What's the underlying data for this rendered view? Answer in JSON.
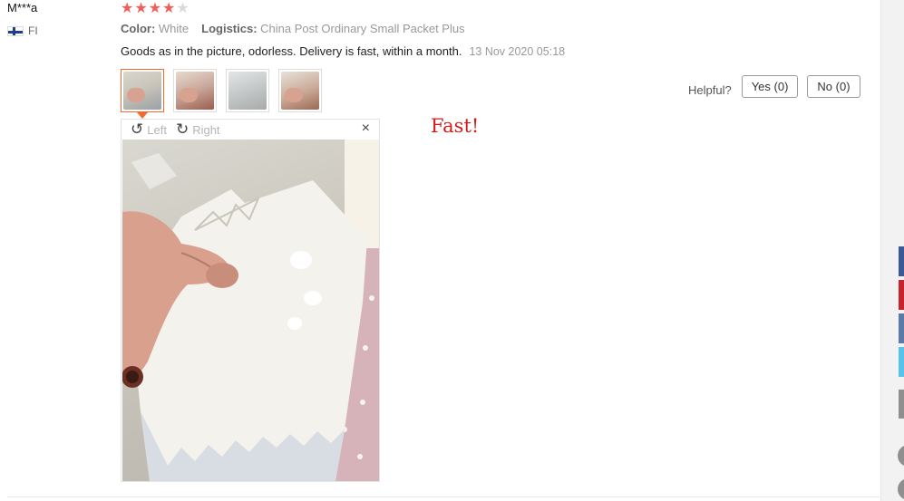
{
  "reviewer": {
    "name": "M***a",
    "country_code": "FI"
  },
  "rating": {
    "stars_filled": 4,
    "stars_total": 5
  },
  "attributes": [
    {
      "label": "Color:",
      "value": "White"
    },
    {
      "label": "Logistics:",
      "value": "China Post Ordinary Small Packet Plus"
    }
  ],
  "review": {
    "text": "Goods as in the picture, odorless. Delivery is fast, within a month.",
    "date": "13 Nov 2020 05:18"
  },
  "helpful": {
    "label": "Helpful?",
    "yes": "Yes (0)",
    "no": "No (0)"
  },
  "viewer": {
    "rotate_left": "Left",
    "rotate_right": "Right",
    "close": "×"
  },
  "annotation": "Fast!",
  "colors": {
    "accent": "#f36b2c",
    "star": "#f25d55",
    "annotation": "#d41b1b"
  }
}
